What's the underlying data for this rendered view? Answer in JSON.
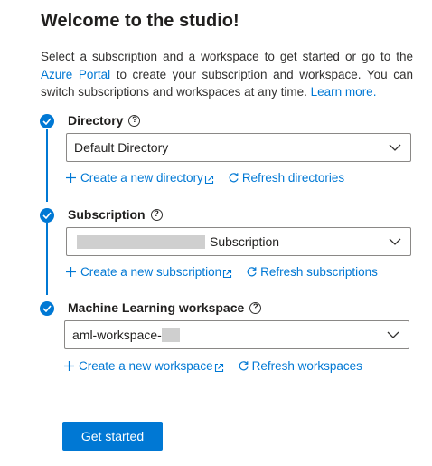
{
  "title": "Welcome to the studio!",
  "intro": {
    "text_1": "Select a subscription and a workspace to get started or go to the",
    "portal_link": "Azure Portal",
    "text_2": "to create your subscription and workspace. You can switch subscriptions and workspaces at any time.",
    "learn_more_link": "Learn more."
  },
  "directory": {
    "label": "Directory",
    "help": "?",
    "value": "Default Directory",
    "create_link": "Create a new directory",
    "refresh_link": "Refresh directories"
  },
  "subscription": {
    "label": "Subscription",
    "help": "?",
    "value_suffix": "Subscription",
    "create_link": "Create a new subscription",
    "refresh_link": "Refresh subscriptions"
  },
  "workspace": {
    "label": "Machine Learning workspace",
    "help": "?",
    "value_prefix": "aml-workspace-",
    "create_link": "Create a new workspace",
    "refresh_link": "Refresh workspaces"
  },
  "get_started_label": "Get started",
  "colors": {
    "accent": "#0078d4",
    "text": "#201f1e",
    "border": "#8a8886",
    "redaction": "#cfcfcf"
  },
  "icons": [
    "check-icon",
    "help-icon",
    "chevron-down-icon",
    "plus-icon",
    "external-link-icon",
    "refresh-icon"
  ]
}
